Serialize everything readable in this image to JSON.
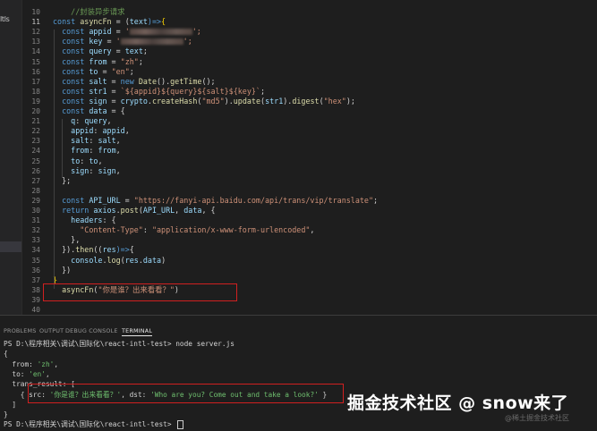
{
  "sidebar": {
    "label": "ltls"
  },
  "editor": {
    "lines": [
      {
        "n": "10",
        "parts": [
          {
            "t": "    ",
            "c": "p"
          },
          {
            "t": "//封装异步请求",
            "c": "c"
          }
        ]
      },
      {
        "n": "11",
        "cur": true,
        "parts": [
          {
            "t": "const ",
            "c": "k"
          },
          {
            "t": "asyncFn",
            "c": "f"
          },
          {
            "t": " = (",
            "c": "p"
          },
          {
            "t": "text",
            "c": "v"
          },
          {
            "t": ")=>",
            "c": "k"
          },
          {
            "t": "{",
            "c": "y"
          }
        ]
      },
      {
        "n": "12",
        "parts": [
          {
            "t": "  const ",
            "c": "k"
          },
          {
            "t": "appid",
            "c": "v"
          },
          {
            "t": " = ",
            "c": "p"
          },
          {
            "t": "'",
            "c": "s"
          },
          {
            "t": "BLUR",
            "c": "blur"
          },
          {
            "t": "';",
            "c": "s"
          }
        ]
      },
      {
        "n": "13",
        "parts": [
          {
            "t": "  const ",
            "c": "k"
          },
          {
            "t": "key",
            "c": "v"
          },
          {
            "t": " = ",
            "c": "p"
          },
          {
            "t": "'",
            "c": "s"
          },
          {
            "t": "BLUR",
            "c": "blur"
          },
          {
            "t": "';",
            "c": "s"
          }
        ]
      },
      {
        "n": "14",
        "parts": [
          {
            "t": "  const ",
            "c": "k"
          },
          {
            "t": "query",
            "c": "v"
          },
          {
            "t": " = ",
            "c": "p"
          },
          {
            "t": "text",
            "c": "v"
          },
          {
            "t": ";",
            "c": "p"
          }
        ]
      },
      {
        "n": "15",
        "parts": [
          {
            "t": "  const ",
            "c": "k"
          },
          {
            "t": "from",
            "c": "v"
          },
          {
            "t": " = ",
            "c": "p"
          },
          {
            "t": "\"zh\"",
            "c": "s"
          },
          {
            "t": ";",
            "c": "p"
          }
        ]
      },
      {
        "n": "16",
        "parts": [
          {
            "t": "  const ",
            "c": "k"
          },
          {
            "t": "to",
            "c": "v"
          },
          {
            "t": " = ",
            "c": "p"
          },
          {
            "t": "\"en\"",
            "c": "s"
          },
          {
            "t": ";",
            "c": "p"
          }
        ]
      },
      {
        "n": "17",
        "parts": [
          {
            "t": "  const ",
            "c": "k"
          },
          {
            "t": "salt",
            "c": "v"
          },
          {
            "t": " = ",
            "c": "p"
          },
          {
            "t": "new ",
            "c": "k"
          },
          {
            "t": "Date",
            "c": "f"
          },
          {
            "t": "().",
            "c": "p"
          },
          {
            "t": "getTime",
            "c": "f"
          },
          {
            "t": "();",
            "c": "p"
          }
        ]
      },
      {
        "n": "18",
        "parts": [
          {
            "t": "  const ",
            "c": "k"
          },
          {
            "t": "str1",
            "c": "v"
          },
          {
            "t": " = ",
            "c": "p"
          },
          {
            "t": "`${appid}${query}${salt}${key}`",
            "c": "s"
          },
          {
            "t": ";",
            "c": "p"
          }
        ]
      },
      {
        "n": "19",
        "parts": [
          {
            "t": "  const ",
            "c": "k"
          },
          {
            "t": "sign",
            "c": "v"
          },
          {
            "t": " = ",
            "c": "p"
          },
          {
            "t": "crypto",
            "c": "v"
          },
          {
            "t": ".",
            "c": "p"
          },
          {
            "t": "createHash",
            "c": "f"
          },
          {
            "t": "(",
            "c": "p"
          },
          {
            "t": "\"md5\"",
            "c": "s"
          },
          {
            "t": ").",
            "c": "p"
          },
          {
            "t": "update",
            "c": "f"
          },
          {
            "t": "(",
            "c": "p"
          },
          {
            "t": "str1",
            "c": "v"
          },
          {
            "t": ").",
            "c": "p"
          },
          {
            "t": "digest",
            "c": "f"
          },
          {
            "t": "(",
            "c": "p"
          },
          {
            "t": "\"hex\"",
            "c": "s"
          },
          {
            "t": ");",
            "c": "p"
          }
        ]
      },
      {
        "n": "20",
        "parts": [
          {
            "t": "  const ",
            "c": "k"
          },
          {
            "t": "data",
            "c": "v"
          },
          {
            "t": " = {",
            "c": "p"
          }
        ]
      },
      {
        "n": "21",
        "parts": [
          {
            "t": "    q",
            "c": "v"
          },
          {
            "t": ": ",
            "c": "p"
          },
          {
            "t": "query",
            "c": "v"
          },
          {
            "t": ",",
            "c": "p"
          }
        ]
      },
      {
        "n": "22",
        "parts": [
          {
            "t": "    appid",
            "c": "v"
          },
          {
            "t": ": ",
            "c": "p"
          },
          {
            "t": "appid",
            "c": "v"
          },
          {
            "t": ",",
            "c": "p"
          }
        ]
      },
      {
        "n": "23",
        "parts": [
          {
            "t": "    salt",
            "c": "v"
          },
          {
            "t": ": ",
            "c": "p"
          },
          {
            "t": "salt",
            "c": "v"
          },
          {
            "t": ",",
            "c": "p"
          }
        ]
      },
      {
        "n": "24",
        "parts": [
          {
            "t": "    from",
            "c": "v"
          },
          {
            "t": ": ",
            "c": "p"
          },
          {
            "t": "from",
            "c": "v"
          },
          {
            "t": ",",
            "c": "p"
          }
        ]
      },
      {
        "n": "25",
        "parts": [
          {
            "t": "    to",
            "c": "v"
          },
          {
            "t": ": ",
            "c": "p"
          },
          {
            "t": "to",
            "c": "v"
          },
          {
            "t": ",",
            "c": "p"
          }
        ]
      },
      {
        "n": "26",
        "parts": [
          {
            "t": "    sign",
            "c": "v"
          },
          {
            "t": ": ",
            "c": "p"
          },
          {
            "t": "sign",
            "c": "v"
          },
          {
            "t": ",",
            "c": "p"
          }
        ]
      },
      {
        "n": "27",
        "parts": [
          {
            "t": "  };",
            "c": "p"
          }
        ]
      },
      {
        "n": "28",
        "parts": []
      },
      {
        "n": "29",
        "parts": [
          {
            "t": "  const ",
            "c": "k"
          },
          {
            "t": "API_URL",
            "c": "v"
          },
          {
            "t": " = ",
            "c": "p"
          },
          {
            "t": "\"https://fanyi-api.baidu.com/api/trans/vip/translate\"",
            "c": "s"
          },
          {
            "t": ";",
            "c": "p"
          }
        ]
      },
      {
        "n": "30",
        "parts": [
          {
            "t": "  return ",
            "c": "k"
          },
          {
            "t": "axios",
            "c": "v"
          },
          {
            "t": ".",
            "c": "p"
          },
          {
            "t": "post",
            "c": "f"
          },
          {
            "t": "(",
            "c": "p"
          },
          {
            "t": "API_URL",
            "c": "v"
          },
          {
            "t": ", ",
            "c": "p"
          },
          {
            "t": "data",
            "c": "v"
          },
          {
            "t": ", {",
            "c": "p"
          }
        ]
      },
      {
        "n": "31",
        "parts": [
          {
            "t": "    headers",
            "c": "v"
          },
          {
            "t": ": {",
            "c": "p"
          }
        ]
      },
      {
        "n": "32",
        "parts": [
          {
            "t": "      \"Content-Type\"",
            "c": "s"
          },
          {
            "t": ": ",
            "c": "p"
          },
          {
            "t": "\"application/x-www-form-urlencoded\"",
            "c": "s"
          },
          {
            "t": ",",
            "c": "p"
          }
        ]
      },
      {
        "n": "33",
        "parts": [
          {
            "t": "    },",
            "c": "p"
          }
        ]
      },
      {
        "n": "34",
        "parts": [
          {
            "t": "  }).",
            "c": "p"
          },
          {
            "t": "then",
            "c": "f"
          },
          {
            "t": "((",
            "c": "p"
          },
          {
            "t": "res",
            "c": "v"
          },
          {
            "t": ")=>",
            "c": "k"
          },
          {
            "t": "{",
            "c": "p"
          }
        ]
      },
      {
        "n": "35",
        "parts": [
          {
            "t": "    console",
            "c": "v"
          },
          {
            "t": ".",
            "c": "p"
          },
          {
            "t": "log",
            "c": "f"
          },
          {
            "t": "(",
            "c": "p"
          },
          {
            "t": "res",
            "c": "v"
          },
          {
            "t": ".",
            "c": "p"
          },
          {
            "t": "data",
            "c": "v"
          },
          {
            "t": ")",
            "c": "p"
          }
        ]
      },
      {
        "n": "36",
        "parts": [
          {
            "t": "  })",
            "c": "p"
          }
        ]
      },
      {
        "n": "37",
        "parts": [
          {
            "t": "}",
            "c": "y"
          }
        ]
      },
      {
        "n": "38",
        "parts": [
          {
            "t": "  asyncFn",
            "c": "f"
          },
          {
            "t": "(",
            "c": "p"
          },
          {
            "t": "\"你是谁？出来看看？\"",
            "c": "s"
          },
          {
            "t": ")",
            "c": "p"
          }
        ]
      },
      {
        "n": "39",
        "parts": []
      },
      {
        "n": "40",
        "parts": []
      }
    ]
  },
  "panel": {
    "tabs": [
      {
        "label": "PROBLEMS",
        "active": false
      },
      {
        "label": "OUTPUT",
        "active": false
      },
      {
        "label": "DEBUG CONSOLE",
        "active": false
      },
      {
        "label": "TERMINAL",
        "active": true
      }
    ],
    "terminal": [
      [
        {
          "t": "PS D:\\程序相关\\调试\\国际化\\react-intl-test> node server.js",
          "c": "p"
        }
      ],
      [
        {
          "t": "{",
          "c": "p"
        }
      ],
      [
        {
          "t": "  from: ",
          "c": "p"
        },
        {
          "t": "'zh'",
          "c": "g"
        },
        {
          "t": ",",
          "c": "p"
        }
      ],
      [
        {
          "t": "  to: ",
          "c": "p"
        },
        {
          "t": "'en'",
          "c": "g"
        },
        {
          "t": ",",
          "c": "p"
        }
      ],
      [
        {
          "t": "  trans_result: [",
          "c": "p"
        }
      ],
      [
        {
          "t": "    { src: ",
          "c": "p"
        },
        {
          "t": "'你是谁？出来看看？'",
          "c": "g"
        },
        {
          "t": ", dst: ",
          "c": "p"
        },
        {
          "t": "'Who are you? Come out and take a look?'",
          "c": "g"
        },
        {
          "t": " }",
          "c": "p"
        }
      ],
      [
        {
          "t": "  ]",
          "c": "p"
        }
      ],
      [
        {
          "t": "}",
          "c": "p"
        }
      ],
      [
        {
          "t": "PS D:\\程序相关\\调试\\国际化\\react-intl-test> ",
          "c": "p"
        },
        {
          "t": "CURSOR",
          "c": "cursor"
        }
      ]
    ]
  },
  "watermark": {
    "main": "掘金技术社区 @ snow来了",
    "sub": "@稀土掘金技术社区"
  }
}
